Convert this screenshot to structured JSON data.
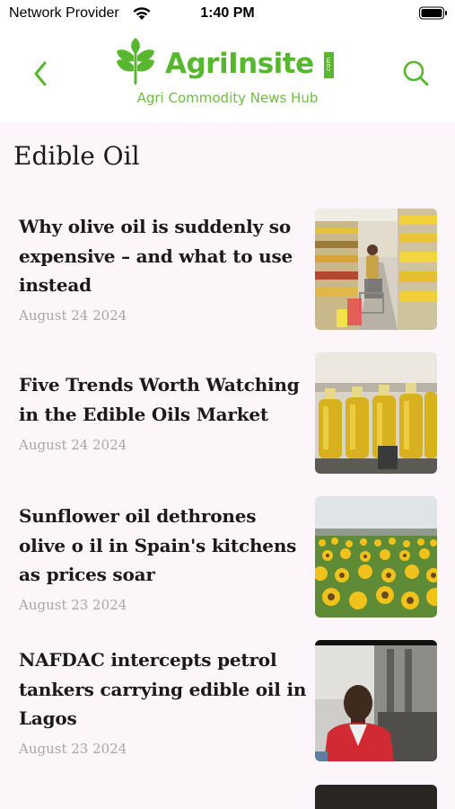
{
  "status_bar": {
    "carrier": "Network Provider",
    "time": "1:40 PM"
  },
  "header": {
    "logo_text": "AgriInsite",
    "logo_suffix": ".com",
    "tagline": "Agri Commodity News Hub",
    "back_icon": "chevron-left-icon",
    "search_icon": "search-icon",
    "accent_color": "#57b72f"
  },
  "page": {
    "title": "Edible Oil"
  },
  "articles": [
    {
      "title": "Why olive oil is suddenly so expensive – and what to use instead",
      "date": "August 24 2024",
      "thumb": "supermarket-aisle"
    },
    {
      "title": "Five Trends Worth Watching in the Edible Oils Market",
      "date": "August 24 2024",
      "thumb": "oil-bottles"
    },
    {
      "title": "Sunflower oil dethrones olive o il in Spain's kitchens as prices soar",
      "date": "August 23 2024",
      "thumb": "sunflower-field"
    },
    {
      "title": "NAFDAC intercepts petrol tankers carrying edible oil in Lagos",
      "date": "August 23 2024",
      "thumb": "man-in-red-vest"
    }
  ]
}
